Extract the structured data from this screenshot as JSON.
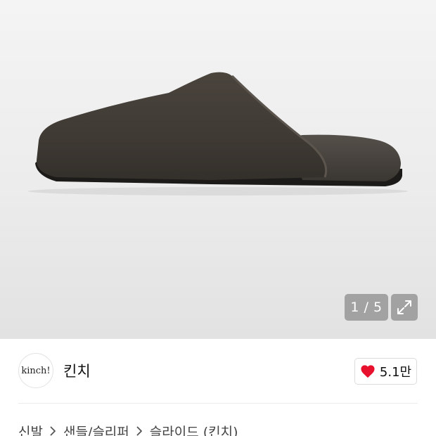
{
  "gallery": {
    "counter": "1 / 5",
    "image_subject": "dark brown suede slide mule",
    "expand_icon": "expand-arrows-icon"
  },
  "brand": {
    "logo_text": "kinch!",
    "name": "킨치",
    "like_count": "5.1만",
    "like_icon": "heart-icon",
    "like_color": "#e8112d"
  },
  "breadcrumb": {
    "items": [
      "신발",
      "샌들/슬리퍼",
      "슬라이드 (킨치)"
    ],
    "separator_icon": "chevron-right-icon"
  }
}
